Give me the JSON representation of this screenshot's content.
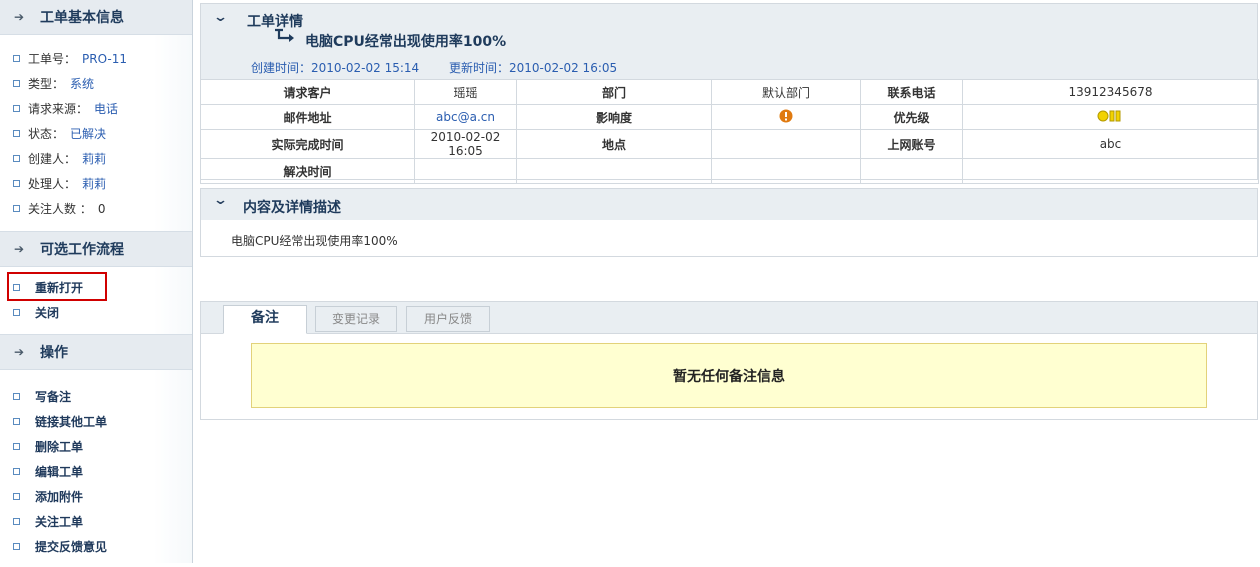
{
  "sidebar": {
    "basic_info": {
      "title": "工单基本信息",
      "items": [
        {
          "key": "工单号：",
          "value": "PRO-11"
        },
        {
          "key": "类型：",
          "value": "系统"
        },
        {
          "key": "请求来源：",
          "value": "电话"
        },
        {
          "key": "状态：",
          "value": "已解决"
        },
        {
          "key": "创建人：",
          "value": "莉莉"
        },
        {
          "key": "处理人：",
          "value": "莉莉"
        },
        {
          "key": "关注人数 ：",
          "value": "0"
        }
      ]
    },
    "workflow": {
      "title": "可选工作流程",
      "items": [
        "重新打开",
        "关闭"
      ]
    },
    "operations": {
      "title": "操作",
      "items": [
        "写备注",
        "链接其他工单",
        "删除工单",
        "编辑工单",
        "添加附件",
        "关注工单",
        "提交反馈意见"
      ]
    }
  },
  "detail": {
    "section_title": "工单详情",
    "ticket_title": "电脑CPU经常出现使用率100%",
    "created_label": "创建时间：",
    "created_value": "2010-02-02 15:14",
    "updated_label": "更新时间：",
    "updated_value": "2010-02-02 16:05",
    "rows": [
      [
        "请求客户",
        "瑶瑶",
        "部门",
        "默认部门",
        "联系电话",
        "13912345678"
      ],
      [
        "邮件地址",
        "abc@a.cn",
        "影响度",
        "",
        "优先级",
        ""
      ],
      [
        "实际完成时间",
        "2010-02-02 16:05",
        "地点",
        "",
        "上网账号",
        "abc"
      ],
      [
        "解决时间",
        "",
        "",
        "",
        "",
        ""
      ]
    ]
  },
  "content": {
    "section_title": "内容及详情描述",
    "text": "电脑CPU经常出现使用率100%"
  },
  "tabs": {
    "items": [
      "备注",
      "变更记录",
      "用户反馈"
    ],
    "active": 0,
    "empty_message": "暂无任何备注信息"
  },
  "colors": {
    "header_bg": "#e9eef2",
    "link_blue": "#2a5db0",
    "note_bg": "#ffffd1",
    "highlight_red": "#d00000"
  }
}
